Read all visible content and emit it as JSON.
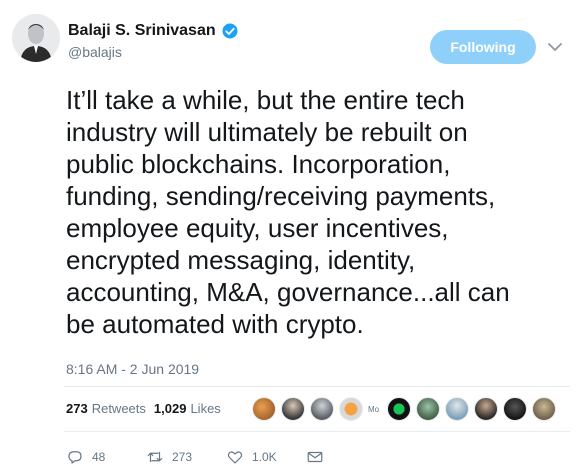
{
  "author": {
    "display_name": "Balaji S. Srinivasan",
    "handle": "@balajis"
  },
  "follow_button_label": "Following",
  "tweet": {
    "lines": [
      "It’ll take a while, but the entire tech",
      "industry will ultimately be rebuilt on",
      "public blockchains. Incorporation,",
      "funding, sending/receiving payments,",
      "employee equity, user incentives,",
      "encrypted messaging, identity,",
      "accounting, M&A, governance...all can",
      "be automated with crypto."
    ],
    "timestamp": "8:16 AM - 2 Jun 2019"
  },
  "stats": {
    "retweets_count": "273",
    "retweets_label": "Retweets",
    "likes_count": "1,029",
    "likes_label": "Likes"
  },
  "likers_text_avatar": "Mo",
  "actions": {
    "reply_count": "48",
    "retweet_count": "273",
    "like_count": "1.0K"
  },
  "colors": {
    "follow_button": "#8ed0f9",
    "verified_badge": "#1da1f2",
    "secondary_text": "#657786"
  },
  "icons": [
    "verified-badge-icon",
    "chevron-down-icon",
    "reply-icon",
    "retweet-icon",
    "heart-icon",
    "mail-icon"
  ]
}
